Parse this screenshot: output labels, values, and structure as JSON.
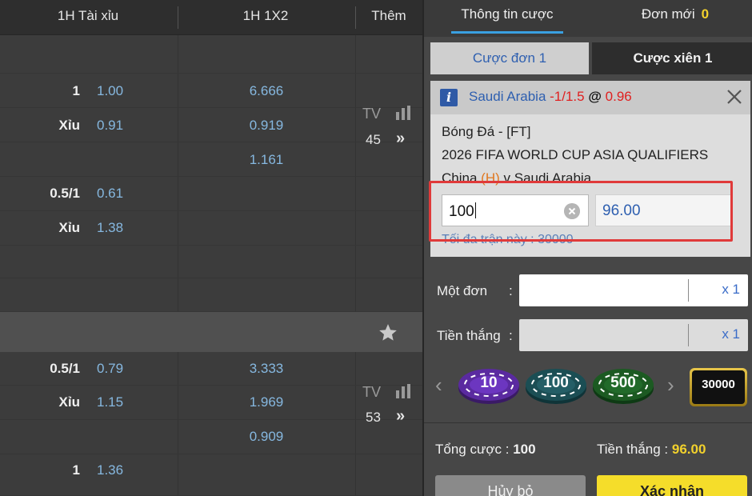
{
  "table": {
    "headers": {
      "ou": "1H Tài xỉu",
      "x12": "1H 1X2",
      "more": "Thêm"
    },
    "group1": {
      "rows": [
        {
          "label": "1",
          "odd": "1.00",
          "x12": "6.666"
        },
        {
          "label": "Xỉu",
          "odd": "0.91",
          "x12": "0.919"
        },
        {
          "label": "",
          "odd": "",
          "x12": "1.161"
        },
        {
          "label": "0.5/1",
          "odd": "0.61",
          "x12": ""
        },
        {
          "label": "Xỉu",
          "odd": "1.38",
          "x12": ""
        }
      ],
      "tv": "TV",
      "count": "45",
      "arrow": "»"
    },
    "group2": {
      "rows": [
        {
          "label": "0.5/1",
          "odd": "0.79",
          "x12": "3.333"
        },
        {
          "label": "Xỉu",
          "odd": "1.15",
          "x12": "1.969"
        },
        {
          "label": "",
          "odd": "",
          "x12": "0.909"
        },
        {
          "label": "1",
          "odd": "1.36",
          "x12": ""
        }
      ],
      "tv": "TV",
      "count": "53",
      "arrow": "»"
    }
  },
  "panel": {
    "tabs": {
      "bet_info": "Thông tin cược",
      "new_orders": "Đơn mới",
      "new_orders_count": "0"
    },
    "bet_types": {
      "single": "Cược đơn 1",
      "combo": "Cược xiên 1"
    },
    "slip": {
      "team": "Saudi Arabia",
      "handicap": "-1/1.5",
      "at": "@",
      "price": "0.96",
      "sport": "Bóng Đá - [FT]",
      "league": "2026 FIFA WORLD CUP ASIA QUALIFIERS",
      "home": "China",
      "home_mark": "(H)",
      "vs": "v",
      "away": "Saudi Arabia",
      "stake": "100",
      "win": "96.00",
      "max": "Tối đa trận này : 30000"
    },
    "single_label": "Một đơn",
    "win_label": "Tiền thắng",
    "colon": ":",
    "mult": "x 1",
    "chips": [
      "10",
      "100",
      "500",
      "30000"
    ],
    "totals": {
      "stake_label": "Tổng cược :",
      "stake": "100",
      "win_label": "Tiền thắng :",
      "win": "96.00"
    },
    "buttons": {
      "cancel": "Hủy bỏ",
      "confirm": "Xác nhận"
    }
  },
  "colors": {
    "accent": "#3aa0e0",
    "odds": "#86b8e0",
    "highlight": "#e03a3a",
    "yellow": "#f2d12c"
  }
}
